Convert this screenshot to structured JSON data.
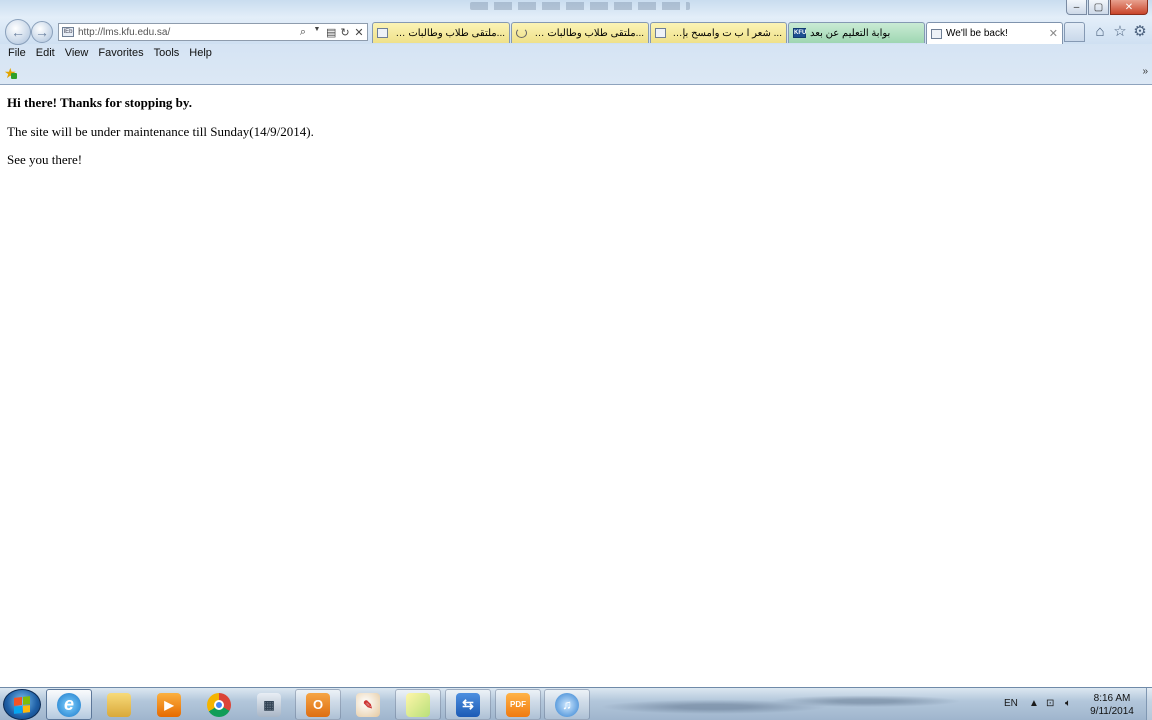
{
  "browser": {
    "address_url": "http://lms.kfu.edu.sa/",
    "favicon_label": "IEb",
    "tabs": [
      {
        "label": "...ملتقى طلاب وطالبات جامعة الم",
        "style": "yellow",
        "icon": "page-icon"
      },
      {
        "label": "...ملتقى طلاب وطالبات جامعة الم",
        "style": "yellow",
        "icon": "loading-icon"
      },
      {
        "label": "... شعر أ ب ت وامسح بإصبعي",
        "style": "yellow",
        "icon": "page-icon"
      },
      {
        "label": "بوابة التعليم عن بعد",
        "style": "green",
        "icon": "kfu-icon",
        "icon_text": "KFU"
      },
      {
        "label": "We'll be back!",
        "style": "active",
        "icon": "page-icon",
        "close": "✕"
      }
    ],
    "window_controls": {
      "minimize": "–",
      "maximize": "▢",
      "close": "✕"
    },
    "toolbar_icons": [
      "home-icon",
      "favorites-star-icon",
      "gear-icon"
    ],
    "address_icons": [
      "search-icon",
      "compatibility-icon",
      "refresh-icon",
      "stop-icon"
    ],
    "menu": [
      "File",
      "Edit",
      "View",
      "Favorites",
      "Tools",
      "Help"
    ],
    "favbar_chevron": "»"
  },
  "page": {
    "heading": "Hi there! Thanks for stopping by.",
    "line1": "The site will be under maintenance till Sunday(14/9/2014).",
    "line2": "See you there!"
  },
  "taskbar": {
    "apps": [
      "internet-explorer",
      "windows-explorer",
      "media-player",
      "chrome",
      "calculator",
      "outlook",
      "paint",
      "notes",
      "team-viewer",
      "foxit-pdf",
      "itunes"
    ],
    "active_app": "internet-explorer",
    "pdf_label": "PDF",
    "language": "EN",
    "time": "8:16 AM",
    "date": "9/11/2014"
  },
  "colors": {
    "tab_yellow": "#efe18a",
    "tab_green": "#9fd6b2",
    "accent_blue": "#1e5fa6"
  }
}
